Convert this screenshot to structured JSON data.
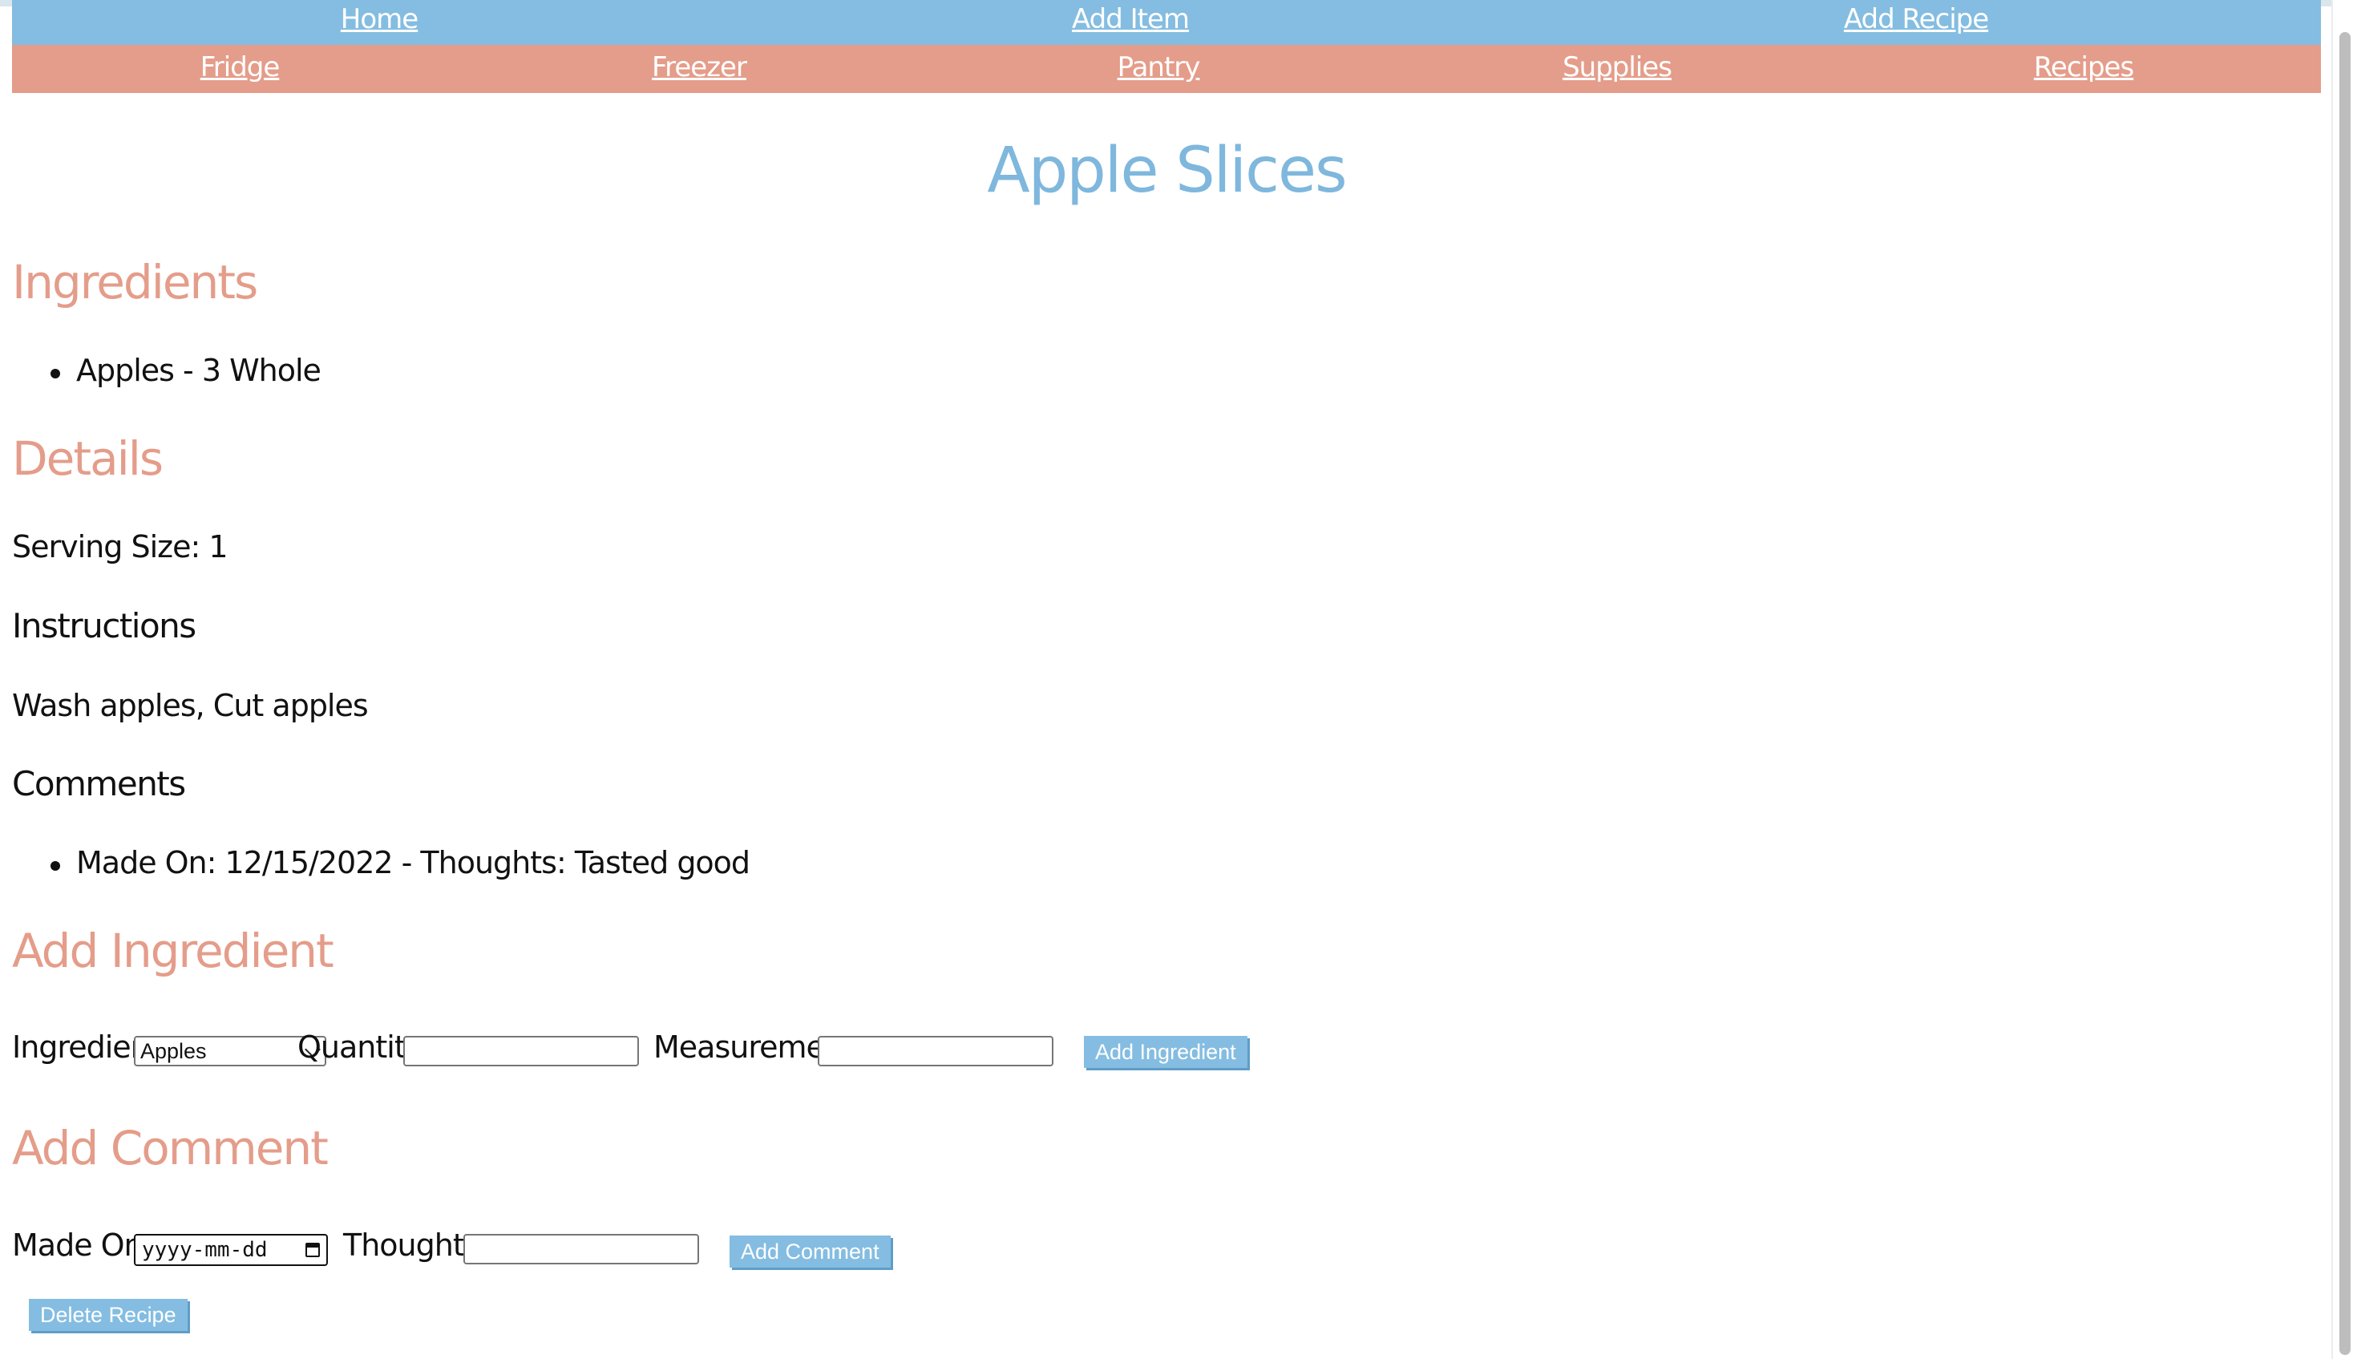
{
  "nav_primary": {
    "home": "Home",
    "add_item": "Add Item",
    "add_recipe": "Add Recipe"
  },
  "nav_secondary": {
    "fridge": "Fridge",
    "freezer": "Freezer",
    "pantry": "Pantry",
    "supplies": "Supplies",
    "recipes": "Recipes"
  },
  "recipe": {
    "title": "Apple Slices",
    "ingredients_heading": "Ingredients",
    "ingredients": [
      "Apples - 3 Whole"
    ],
    "details_heading": "Details",
    "serving_size": "Serving Size: 1",
    "instructions_heading": "Instructions",
    "instructions": "Wash apples, Cut apples",
    "comments_heading": "Comments",
    "comments": [
      "Made On: 12/15/2022 - Thoughts: Tasted good"
    ]
  },
  "add_ingredient": {
    "heading": "Add Ingredient",
    "ingredient_label": "Ingredient:",
    "ingredient_selected": "Apples",
    "quantity_label": "Quantity:",
    "quantity_value": "",
    "measurement_label": "Measurement:",
    "measurement_value": "",
    "button": "Add Ingredient"
  },
  "add_comment": {
    "heading": "Add Comment",
    "made_on_label": "Made On:",
    "made_on_placeholder": "yyyy-mm-dd",
    "thoughts_label": "Thoughts:",
    "thoughts_value": "",
    "button": "Add Comment"
  },
  "delete_button": "Delete Recipe",
  "colors": {
    "primary_nav": "#84bde1",
    "secondary_nav": "#e49d8a",
    "title": "#7fb7dd",
    "section_heading": "#e49d8a",
    "button": "#84bde1"
  }
}
